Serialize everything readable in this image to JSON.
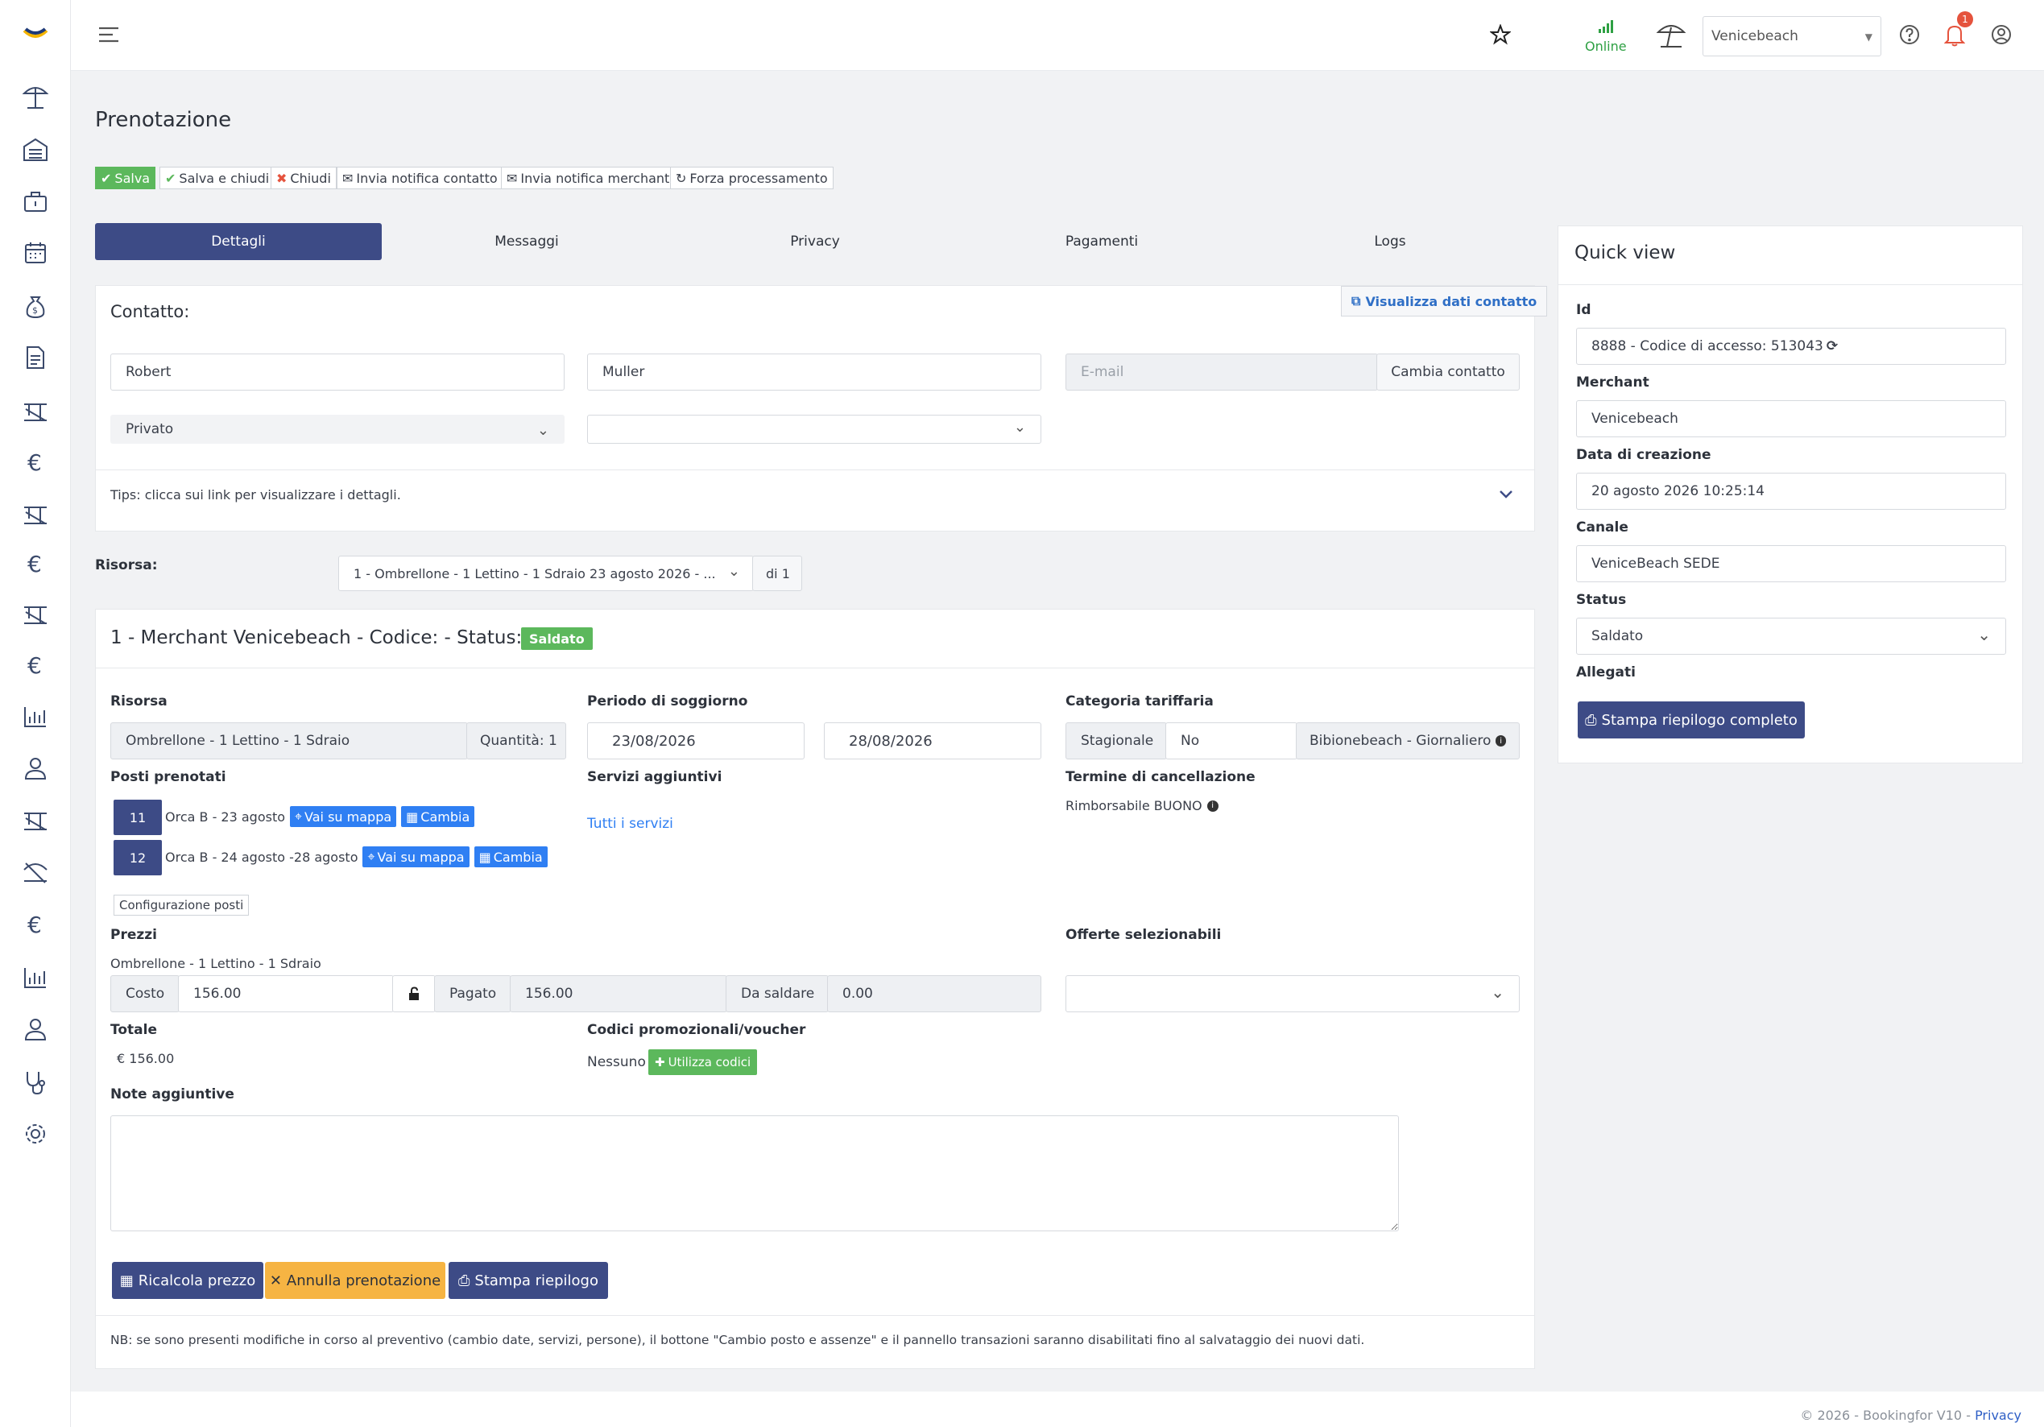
{
  "topbar": {
    "online_label": "Online",
    "merchant_select": "Venicebeach",
    "notification_count": "1"
  },
  "page": {
    "title": "Prenotazione"
  },
  "toolbar": {
    "save": "Salva",
    "save_close": "Salva e chiudi",
    "close": "Chiudi",
    "notify_contact": "Invia notifica contatto",
    "notify_merchant": "Invia notifica merchant",
    "force_process": "Forza processamento"
  },
  "tabs": [
    {
      "label": "Dettagli"
    },
    {
      "label": "Messaggi"
    },
    {
      "label": "Privacy"
    },
    {
      "label": "Pagamenti"
    },
    {
      "label": "Logs"
    }
  ],
  "contact": {
    "heading": "Contatto:",
    "view_link": "Visualizza dati contatto",
    "first_name": "Robert",
    "last_name": "Muller",
    "email_placeholder": "E-mail",
    "change_button": "Cambia contatto",
    "type_select": "Privato",
    "tips": "Tips: clicca sui link per visualizzare i dettagli."
  },
  "resource_selector": {
    "label": "Risorsa:",
    "value": "1 - Ombrellone - 1 Lettino - 1 Sdraio 23 agosto 2026 - ...",
    "count": "di 1"
  },
  "booking": {
    "heading": "1 - Merchant Venicebeach - Codice: - Status:",
    "status_badge": "Saldato",
    "resource_label": "Risorsa",
    "resource_value": "Ombrellone - 1 Lettino - 1 Sdraio",
    "quantity": "Quantità: 1",
    "period_label": "Periodo di soggiorno",
    "date_from": "23/08/2026",
    "date_to": "28/08/2026",
    "category_label": "Categoria tariffaria",
    "category_season": "Stagionale",
    "category_no": "No",
    "category_name": "Bibionebeach - Giornaliero",
    "seats_label": "Posti prenotati",
    "seats": [
      {
        "number": "11",
        "text": "Orca B - 23 agosto",
        "map": "Vai su mappa",
        "change": "Cambia"
      },
      {
        "number": "12",
        "text": "Orca B - 24 agosto -28 agosto",
        "map": "Vai su mappa",
        "change": "Cambia"
      }
    ],
    "services_label": "Servizi aggiuntivi",
    "services_link": "Tutti i servizi",
    "cancel_label": "Termine di cancellazione",
    "cancel_value": "Rimborsabile BUONO",
    "config_button": "Configurazione posti",
    "prices_label": "Prezzi",
    "price_item": "Ombrellone - 1 Lettino - 1 Sdraio",
    "cost_label": "Costo",
    "cost_value": "156.00",
    "paid_label": "Pagato",
    "paid_value": "156.00",
    "due_label": "Da saldare",
    "due_value": "0.00",
    "offers_label": "Offerte selezionabili",
    "total_label": "Totale",
    "total_value": "€ 156.00",
    "promo_label": "Codici promozionali/voucher",
    "promo_value": "Nessuno",
    "promo_button": "Utilizza codici",
    "notes_label": "Note aggiuntive",
    "recalc_button": "Ricalcola prezzo",
    "cancel_booking_button": "Annulla prenotazione",
    "print_button": "Stampa riepilogo",
    "note_text": "NB: se sono presenti modifiche in corso al preventivo (cambio date, servizi, persone), il bottone \"Cambio posto e assenze\" e il pannello transazioni saranno disabilitati fino al salvataggio dei nuovi dati."
  },
  "quickview": {
    "title": "Quick view",
    "id_label": "Id",
    "id_value": "8888 - Codice di accesso: 513043",
    "merchant_label": "Merchant",
    "merchant_value": "Venicebeach",
    "created_label": "Data di creazione",
    "created_value": "20 agosto 2026 10:25:14",
    "channel_label": "Canale",
    "channel_value": "VeniceBeach SEDE",
    "status_label": "Status",
    "status_value": "Saldato",
    "attachments_label": "Allegati",
    "print_full": "Stampa riepilogo completo"
  },
  "footer": {
    "copyright": "© 2026 - Bookingfor V10 - ",
    "privacy": "Privacy"
  },
  "colors": {
    "primary": "#3d4b86",
    "success": "#5cb85c",
    "warning": "#f6b443",
    "link": "#2f7ff3",
    "badge": "#e5533d"
  }
}
